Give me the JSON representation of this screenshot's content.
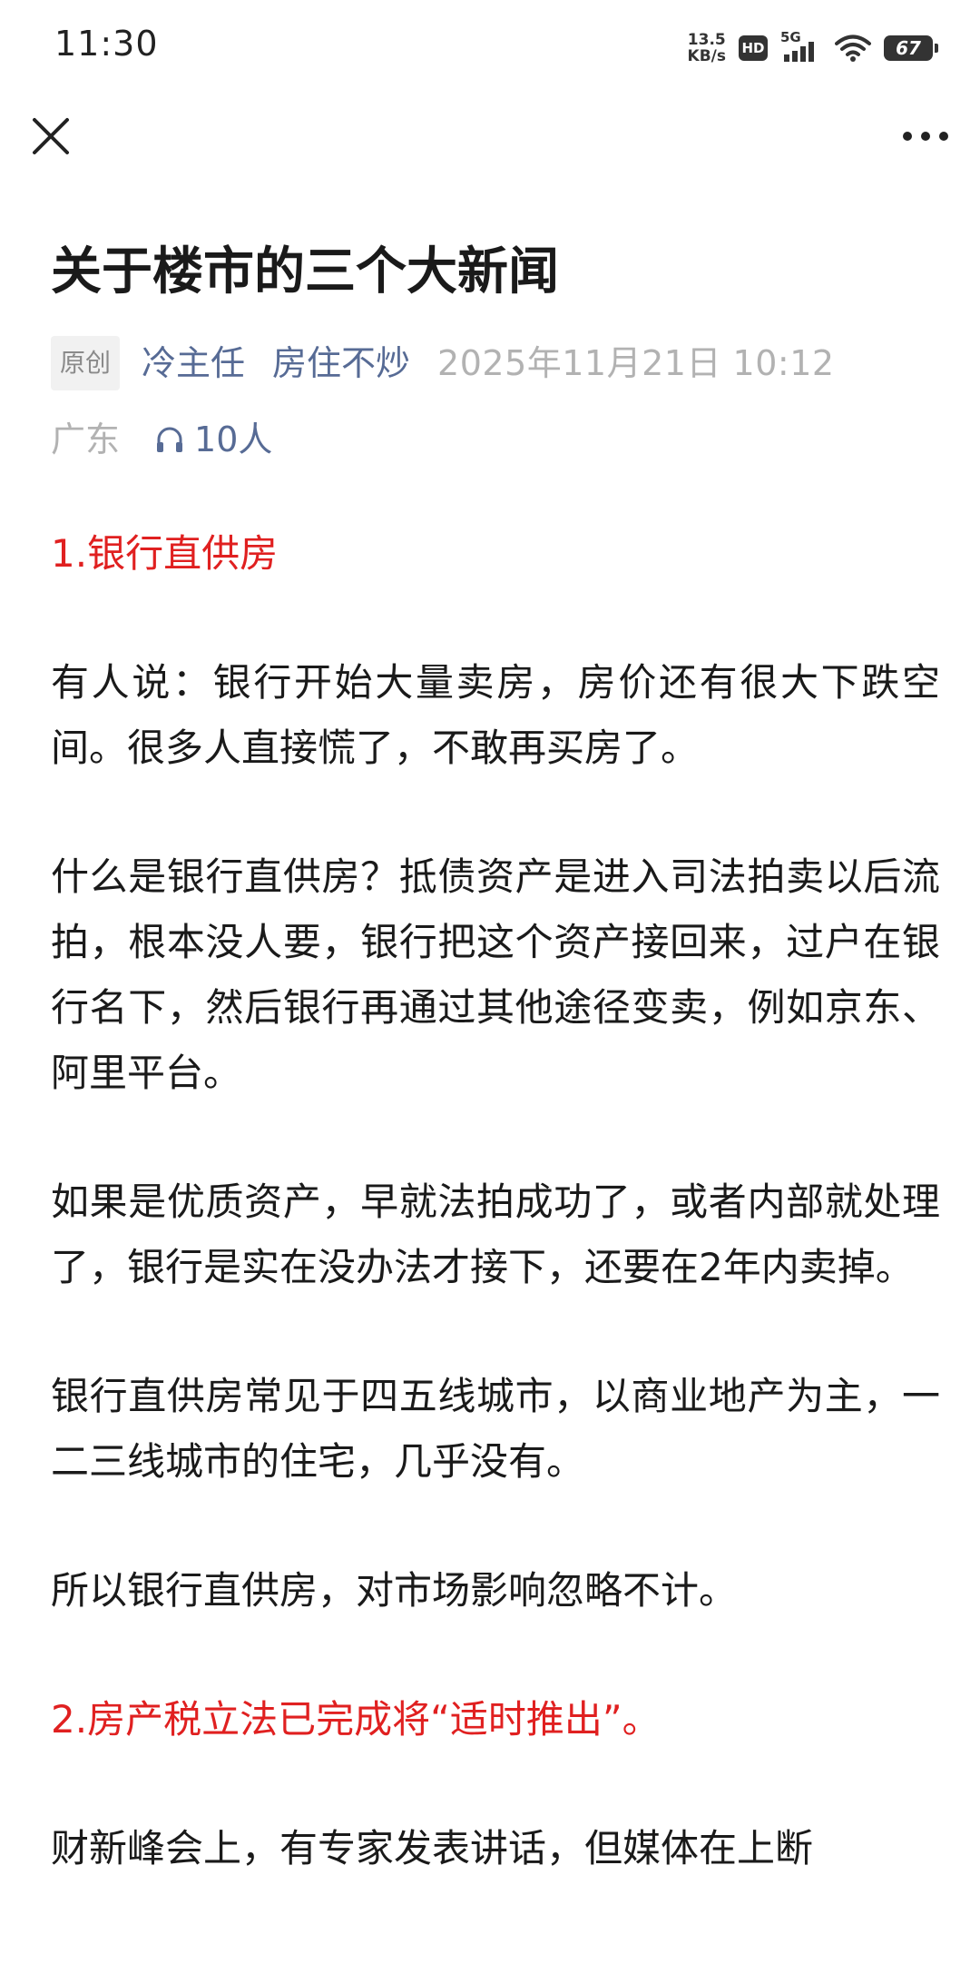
{
  "status_bar": {
    "time": "11:30",
    "net_speed_value": "13.5",
    "net_speed_unit": "KB/s",
    "hd": "HD",
    "network": "5G",
    "battery": "67"
  },
  "nav": {
    "close_icon": "close-icon",
    "more_icon": "more-horizontal-icon"
  },
  "article": {
    "title": "关于楼市的三个大新闻",
    "original_badge": "原创",
    "author": "冷主任",
    "column": "房住不炒",
    "publish_time": "2025年11月21日 10:12",
    "location": "广东",
    "listeners": "10人",
    "accent_color": "#576b95",
    "heading_color": "#e02020",
    "paragraphs": [
      "1.银行直供房",
      "有人说：银行开始大量卖房，房价还有很大下跌空间。很多人直接慌了，不敢再买房了。",
      "什么是银行直供房？抵债资产是进入司法拍卖以后流拍，根本没人要，银行把这个资产接回来，过户在银行名下，然后银行再通过其他途径变卖，例如京东、阿里平台。",
      "如果是优质资产，早就法拍成功了，或者内部就处理了，银行是实在没办法才接下，还要在2年内卖掉。",
      "银行直供房常见于四五线城市，以商业地产为主，一二三线城市的住宅，几乎没有。",
      "所以银行直供房，对市场影响忽略不计。",
      "2.房产税立法已完成将“适时推出”。",
      "财新峰会上，有专家发表讲话，但媒体在上断"
    ]
  }
}
